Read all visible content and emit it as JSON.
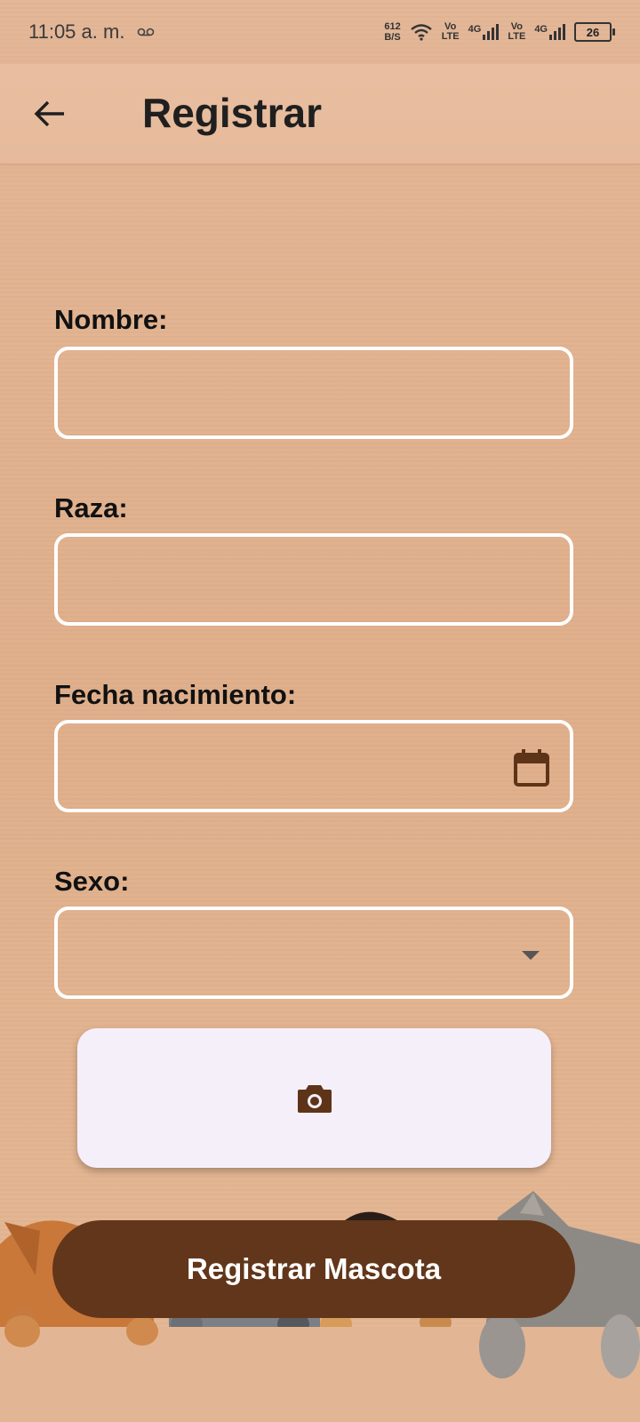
{
  "status_bar": {
    "time": "11:05 a. m.",
    "net_speed_value": "612",
    "net_speed_unit": "B/S",
    "volte_1_top": "Vo",
    "volte_1_bottom": "LTE",
    "network_1": "4G",
    "volte_2_top": "Vo",
    "volte_2_bottom": "LTE",
    "network_2": "4G",
    "battery": "26"
  },
  "app_bar": {
    "title": "Registrar",
    "back_icon": "arrow-back-icon"
  },
  "form": {
    "nombre": {
      "label": "Nombre:",
      "value": ""
    },
    "raza": {
      "label": "Raza:",
      "value": ""
    },
    "fecha": {
      "label": "Fecha nacimiento:",
      "value": "",
      "icon": "calendar-icon"
    },
    "sexo": {
      "label": "Sexo:",
      "value": "",
      "icon": "dropdown-arrow-icon"
    }
  },
  "photo_button": {
    "icon": "camera-icon"
  },
  "register_button": {
    "label": "Registrar Mascota"
  },
  "colors": {
    "background": "#dfae8a",
    "primary": "#62361a",
    "field_border": "#ffffff",
    "photo_button_bg": "#f5effa",
    "icon_brown": "#5e3418"
  }
}
